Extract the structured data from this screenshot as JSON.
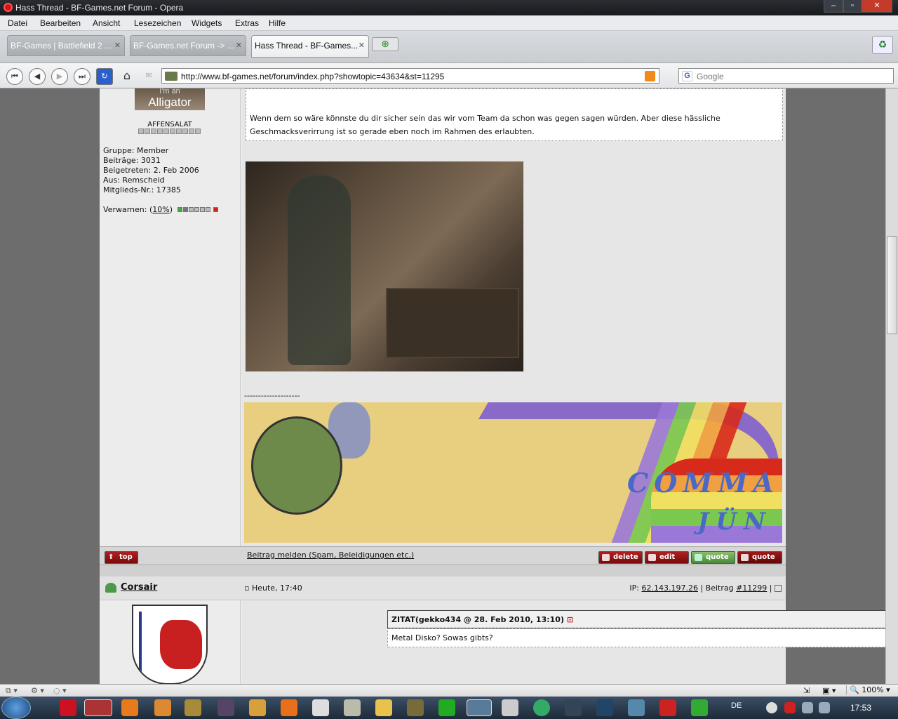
{
  "window": {
    "title": "Hass Thread - BF-Games.net Forum - Opera"
  },
  "menu": [
    "Datei",
    "Bearbeiten",
    "Ansicht",
    "Lesezeichen",
    "Widgets",
    "Extras",
    "Hilfe"
  ],
  "tabs": [
    {
      "label": "BF-Games | Battlefield 2 ..."
    },
    {
      "label": "BF-Games.net Forum -> ..."
    },
    {
      "label": "Hass Thread - BF-Games..."
    }
  ],
  "address": {
    "url": "http://www.bf-games.net/forum/index.php?showtopic=43634&st=11295"
  },
  "search": {
    "placeholder": "Google"
  },
  "post1": {
    "avatar_text": "Alligator",
    "avatar_text_top": "I'm an",
    "rank": "AFFENSALAT",
    "group": "Gruppe: Member",
    "posts": "Beiträge: 3031",
    "joined": "Beigetreten: 2. Feb 2006",
    "from": "Aus: Remscheid",
    "member_no": "Mitglieds-Nr.: 17385",
    "warn_label": "Verwarnen: (",
    "warn_value": "10%",
    "warn_close": ")",
    "quote_line1": "Wenn dem so wäre könnste du dir sicher sein das wir vom Team da schon was gegen sagen würden. Aber diese hässliche",
    "quote_line2": "Geschmacksverirrung ist so gerade eben noch im Rahmen des erlaubten.",
    "separator": "--------------------",
    "banner_text1": "COMMA",
    "banner_text2": "JÜN"
  },
  "actions": {
    "top": "top",
    "report": "Beitrag melden (Spam, Beleidigungen etc.)",
    "delete": "delete",
    "edit": "edit",
    "quote_multi": "quote",
    "quote": "quote"
  },
  "post2": {
    "author": "Corsair",
    "date": "Heute, 17:40",
    "ip_label": "IP: ",
    "ip": "62.143.197.26",
    "post_label": " | Beitrag ",
    "post_no": "#11299",
    "post_end": " |",
    "quote_header": "ZITAT(gekko434 @ 28. Feb 2010, 13:10)",
    "quote_body": "Metal Disko? Sowas gibts?"
  },
  "status": {
    "zoom": "100%"
  },
  "taskbar": {
    "lang": "DE",
    "time": "17:53"
  },
  "colors": {
    "forum_bg": "#6d6d6d",
    "button_red": "#9a1010",
    "button_green": "#6aa050"
  }
}
